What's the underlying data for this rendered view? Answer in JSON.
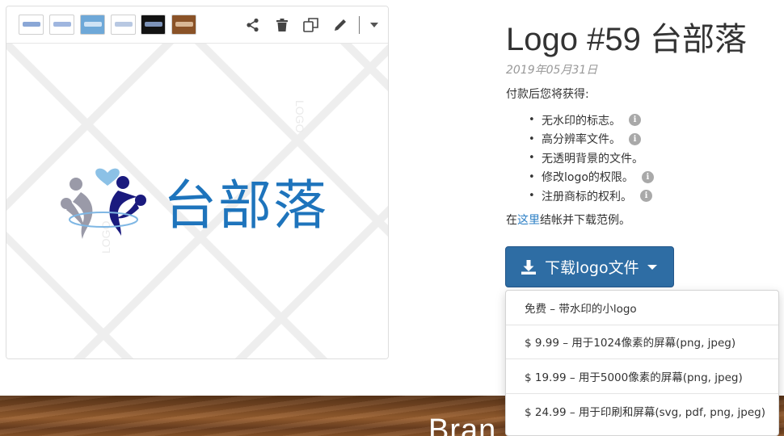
{
  "toolbar": {
    "thumbnails": [
      {
        "name": "white",
        "bg": "#ffffff",
        "fg": "#8aa7d6"
      },
      {
        "name": "white-outline",
        "bg": "#ffffff",
        "fg": "#9fb6df"
      },
      {
        "name": "blue",
        "bg": "#6ea8d8",
        "fg": "#cfe3f5"
      },
      {
        "name": "light",
        "bg": "#ffffff",
        "fg": "#b8c8e2"
      },
      {
        "name": "black",
        "bg": "#121212",
        "fg": "#7d93b8"
      },
      {
        "name": "wood",
        "bg": "#8a5227",
        "fg": "#d9b795"
      }
    ],
    "icons": [
      "share-icon",
      "trash-icon",
      "copy-icon",
      "pencil-icon",
      "dropdown-caret-icon"
    ]
  },
  "preview": {
    "watermark": "LOGO",
    "logo_text": "台部落",
    "colors": {
      "brand_blue": "#1e74bc",
      "navy": "#1a1a7e",
      "grey": "#9a9aa8",
      "heart": "#8cc1e6"
    }
  },
  "info": {
    "title": "Logo #59 台部落",
    "date": "2019年05月31日",
    "intro": "付款后您将获得:",
    "features": [
      {
        "label": "无水印的标志。",
        "info": true
      },
      {
        "label": "高分辨率文件。",
        "info": true
      },
      {
        "label": "无透明背景的文件。",
        "info": false
      },
      {
        "label": "修改logo的权限。",
        "info": true
      },
      {
        "label": "注册商标的权利。",
        "info": true
      }
    ],
    "note_prefix": "在",
    "note_link": "这里",
    "note_suffix": "结帐并下载范例。"
  },
  "download": {
    "button_label": "下载logo文件",
    "options": [
      "免费 – 带水印的小logo",
      "$ 9.99 – 用于1024像素的屏幕(png, jpeg)",
      "$ 19.99 – 用于5000像素的屏幕(png, jpeg)",
      "$ 24.99 – 用于印刷和屏幕(svg, pdf, png, jpeg)"
    ],
    "accent": "#2e6da4"
  },
  "banner": {
    "text": "Bran"
  }
}
